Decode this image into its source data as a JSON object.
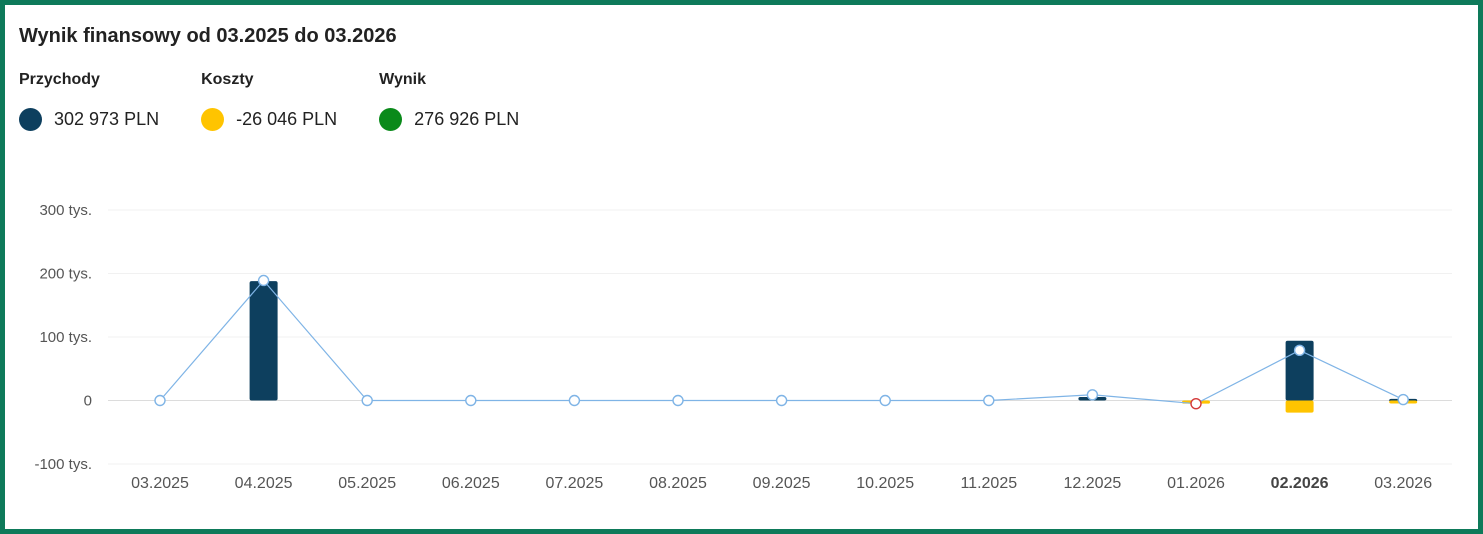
{
  "title": "Wynik finansowy od 03.2025 do 03.2026",
  "legend": {
    "revenue": {
      "label": "Przychody",
      "value": "302 973 PLN",
      "color": "#0d3f5e"
    },
    "costs": {
      "label": "Koszty",
      "value": "-26 046 PLN",
      "color": "#ffc400"
    },
    "result": {
      "label": "Wynik",
      "value": "276 926 PLN",
      "color": "#0a8a1a"
    }
  },
  "chart_data": {
    "type": "bar",
    "categories": [
      "03.2025",
      "04.2025",
      "05.2025",
      "06.2025",
      "07.2025",
      "08.2025",
      "09.2025",
      "10.2025",
      "11.2025",
      "12.2025",
      "01.2026",
      "02.2026",
      "03.2026"
    ],
    "active_category": "02.2026",
    "y_ticks": [
      {
        "value": 300000,
        "label": "300 tys."
      },
      {
        "value": 200000,
        "label": "200 tys."
      },
      {
        "value": 100000,
        "label": "100 tys."
      },
      {
        "value": 0,
        "label": "0"
      },
      {
        "value": -100000,
        "label": "-100 tys."
      }
    ],
    "ylim": [
      -100000,
      300000
    ],
    "grid": true,
    "series": [
      {
        "name": "Przychody",
        "kind": "bar",
        "color": "#0d3f5e",
        "values": [
          0,
          188000,
          0,
          0,
          0,
          0,
          0,
          0,
          0,
          5500,
          0,
          94000,
          2500
        ]
      },
      {
        "name": "Koszty",
        "kind": "bar",
        "color": "#ffc400",
        "values": [
          0,
          0,
          0,
          0,
          0,
          0,
          0,
          0,
          0,
          0,
          -5000,
          -19000,
          -1500
        ]
      },
      {
        "name": "Wynik",
        "kind": "line",
        "color": "#7fb4e6",
        "values": [
          0,
          189000,
          0,
          0,
          0,
          0,
          0,
          0,
          0,
          9000,
          -5000,
          79000,
          1500
        ],
        "negative_marker_color": "#d43a3a"
      }
    ]
  }
}
